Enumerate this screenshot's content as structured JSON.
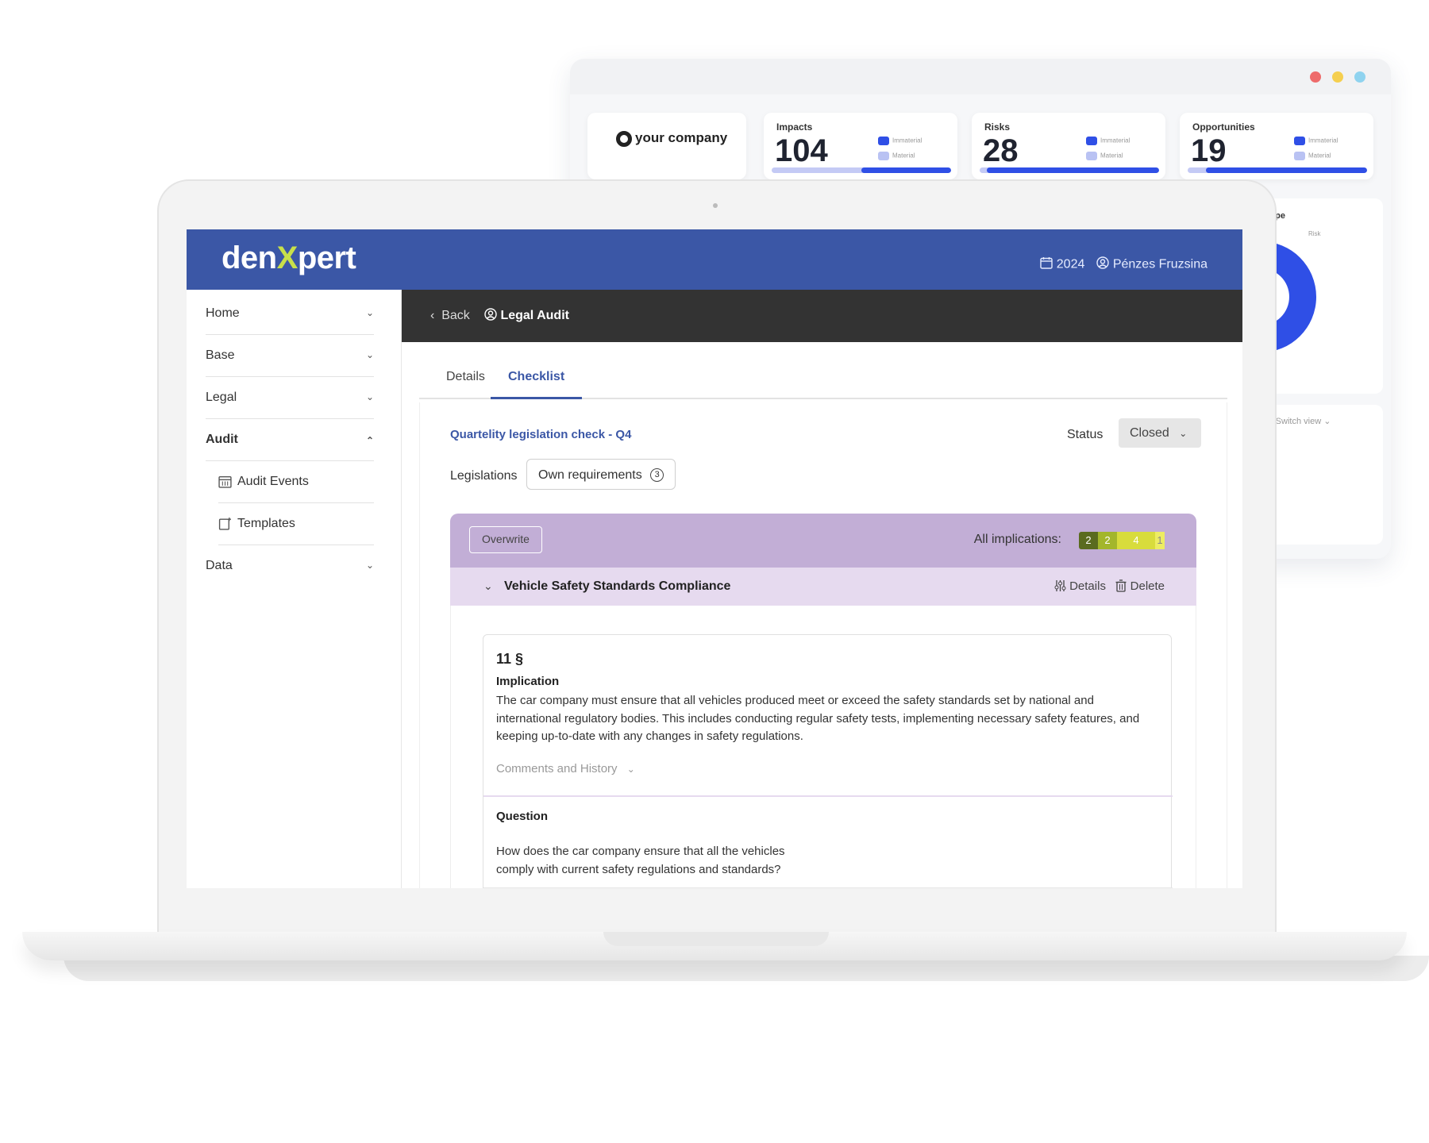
{
  "background_dashboard": {
    "company_logo_text": "your company",
    "cards": [
      {
        "title": "Impacts",
        "value": "104",
        "legend": [
          "Immaterial",
          "Material"
        ],
        "material_fraction": 0.5
      },
      {
        "title": "Risks",
        "value": "28",
        "legend": [
          "Immaterial",
          "Material"
        ],
        "material_fraction": 0.96
      },
      {
        "title": "Opportunities",
        "value": "19",
        "legend": [
          "Immaterial",
          "Material"
        ],
        "material_fraction": 0.9
      }
    ],
    "chart_title_fragment": "ype",
    "chart_legend": "Risk",
    "switch_view": "Switch view",
    "window_dot_colors": [
      "#ee6b6b",
      "#f5cf4f",
      "#8fd3ef"
    ]
  },
  "app": {
    "brand": {
      "prefix": "den",
      "x": "X",
      "suffix": "pert"
    },
    "header": {
      "year": "2024",
      "user": "Pénzes Fruzsina"
    },
    "sidebar": {
      "items": [
        {
          "label": "Home"
        },
        {
          "label": "Base"
        },
        {
          "label": "Legal"
        },
        {
          "label": "Audit"
        },
        {
          "label": "Data"
        }
      ],
      "sub_items": [
        {
          "label": "Audit Events"
        },
        {
          "label": "Templates"
        }
      ]
    },
    "topbar": {
      "back": "Back",
      "title": "Legal Audit"
    },
    "tabs": [
      {
        "label": "Details"
      },
      {
        "label": "Checklist"
      }
    ],
    "active_tab": "Checklist",
    "checklist": {
      "title": "Quartelity legislation check - Q4",
      "status_label": "Status",
      "status_value": "Closed",
      "legislations_label": "Legislations",
      "own_requirements_label": "Own requirements",
      "own_requirements_count": "3",
      "overwrite_label": "Overwrite",
      "all_implications_label": "All implications:",
      "implications": [
        {
          "value": "2",
          "color": "#5a6b1f"
        },
        {
          "value": "2",
          "color": "#a3b62b"
        },
        {
          "value": "4",
          "color": "#d8dc3c"
        },
        {
          "value": "1",
          "color": "#eded62"
        }
      ],
      "group_title": "Vehicle Safety Standards Compliance",
      "details_label": "Details",
      "delete_label": "Delete",
      "item": {
        "section": "11 §",
        "implication_title": "Implication",
        "implication_text": "The car company must ensure that all vehicles produced meet or exceed the safety standards set by national and international regulatory bodies. This includes conducting regular safety tests, implementing necessary safety features, and keeping up-to-date with any changes in safety regulations.",
        "comments_label": "Comments and History",
        "question_title": "Question",
        "question_text": "How does the car company ensure that all the vehicles comply with current safety regulations and standards?"
      }
    },
    "colors": {
      "header_blue": "#3b57a6",
      "dark_strip": "#333333",
      "accent_green": "#c8e04a",
      "group_purple": "#c2aed6",
      "subgroup_purple": "#e6daef"
    }
  }
}
